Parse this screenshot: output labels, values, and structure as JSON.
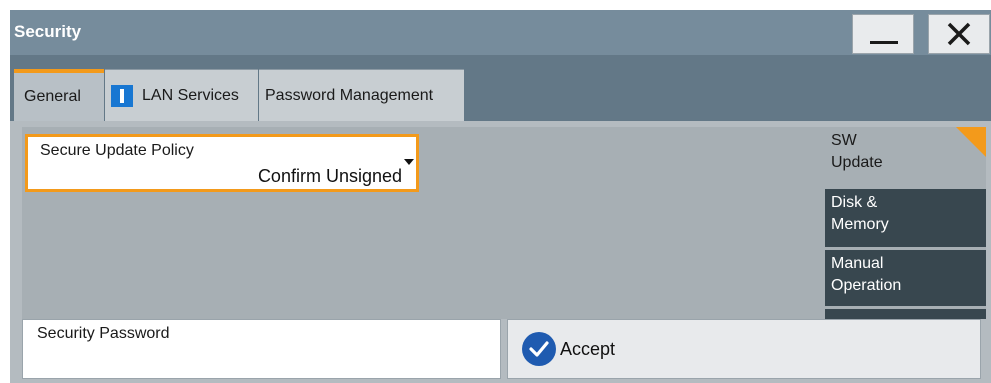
{
  "window": {
    "title": "Security",
    "minimize_icon": "minimize-icon",
    "close_icon": "close-icon"
  },
  "tabs": [
    {
      "label": "General",
      "active": true
    },
    {
      "label": "LAN Services",
      "icon": "info-icon",
      "icon_color": "#1877d2"
    },
    {
      "label": "Password Management"
    }
  ],
  "general": {
    "secure_update_policy": {
      "label": "Secure Update Policy",
      "value": "Confirm Unsigned"
    },
    "security_password": {
      "label": "Security Password",
      "value": ""
    },
    "accept_label": "Accept",
    "accept_icon": "checkmark-icon"
  },
  "side_nav": [
    {
      "label": "SW Update",
      "line1": "SW",
      "line2": "Update",
      "active": true
    },
    {
      "label": "Disk & Memory",
      "line1": "Disk &",
      "line2": "Memory"
    },
    {
      "label": "Manual Operation",
      "line1": "Manual",
      "line2": "Operation"
    }
  ],
  "colors": {
    "accent": "#f39a1b",
    "titlebar": "#768c9c",
    "nav_dark": "#38474f",
    "accept_icon": "#1f5bb0"
  }
}
